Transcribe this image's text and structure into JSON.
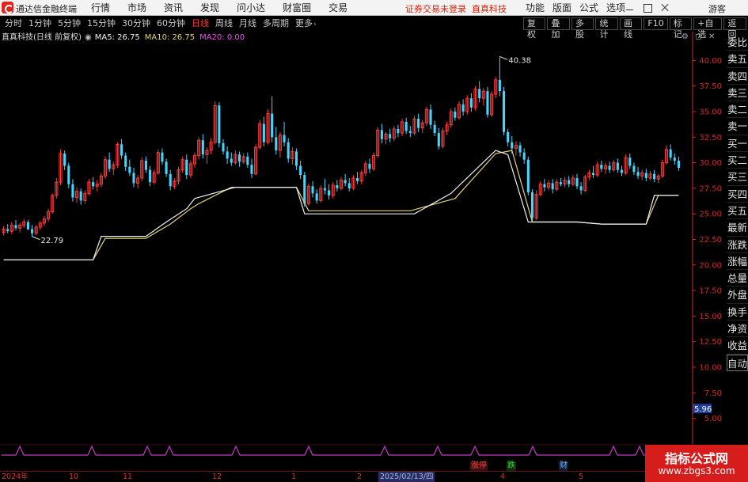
{
  "window": {
    "app_title": "通达信金融终端",
    "login_notice": "证券交易未登录",
    "login_stock": "直真科技",
    "guest_label": "游客"
  },
  "main_menu": [
    "行情",
    "市场",
    "资讯",
    "发现",
    "问小达",
    "财富圈",
    "交易"
  ],
  "right_menu": [
    "功能",
    "版面",
    "公式",
    "选项"
  ],
  "period_tabs": [
    {
      "label": "分时",
      "active": false
    },
    {
      "label": "1分钟",
      "active": false
    },
    {
      "label": "5分钟",
      "active": false
    },
    {
      "label": "15分钟",
      "active": false
    },
    {
      "label": "30分钟",
      "active": false
    },
    {
      "label": "60分钟",
      "active": false
    },
    {
      "label": "日线",
      "active": true
    },
    {
      "label": "周线",
      "active": false
    },
    {
      "label": "月线",
      "active": false
    },
    {
      "label": "多周期",
      "active": false
    },
    {
      "label": "更多",
      "active": false
    }
  ],
  "right_tools": [
    "复权",
    "叠加",
    "多股",
    "统计",
    "画线",
    "F10",
    "标记",
    "+自选",
    "返回"
  ],
  "info": {
    "stock_name": "直真科技(日线 前复权)",
    "ma5_label": "MA5: 26.75",
    "ma10_label": "MA10: 26.75",
    "ma20_label": "MA20: 0.00"
  },
  "side_tabs": [
    "委比",
    "卖五",
    "卖四",
    "卖三",
    "卖二",
    "卖一",
    "买一",
    "买二",
    "买三",
    "买四",
    "买五",
    "最新",
    "涨跌",
    "涨幅",
    "总量",
    "外盘",
    "换手",
    "净资",
    "收益",
    "自动"
  ],
  "y_axis": {
    "ticks": [
      "40.00",
      "37.50",
      "35.00",
      "32.50",
      "30.00",
      "27.50",
      "25.00",
      "22.50",
      "20.00",
      "17.50",
      "15.00",
      "12.50",
      "10.00",
      "7.50",
      "5.00"
    ],
    "current_label": "5.96"
  },
  "annotations": {
    "high": "40.38",
    "low": "22.79"
  },
  "date_ticks": [
    {
      "label": "2024年",
      "highlight": false
    },
    {
      "label": "10",
      "highlight": false
    },
    {
      "label": "11",
      "highlight": false
    },
    {
      "label": "12",
      "highlight": false
    },
    {
      "label": "1",
      "highlight": false
    },
    {
      "label": "2",
      "highlight": false
    },
    {
      "label": "2025/02/13/四",
      "highlight": true
    },
    {
      "label": "4",
      "highlight": false
    },
    {
      "label": "5",
      "highlight": false
    }
  ],
  "events": {
    "zhangting": "涨停",
    "dieting": "跌",
    "cai": "财"
  },
  "watermark": {
    "title": "指标公式网",
    "url": "www.zbgs3.com"
  },
  "colors": {
    "up": "#ff3c3c",
    "down": "#43d6ff",
    "ma_white": "#f0f0f0",
    "ma_yellow": "#e9d27a",
    "ma20": "#ff44ff",
    "axis": "#d02a2a",
    "pulse": "#c03cc0"
  },
  "chart_data": {
    "type": "candlestick",
    "y_range": [
      3.5,
      41.5
    ],
    "candles": [
      {
        "o": 23.2,
        "h": 23.8,
        "l": 22.9,
        "c": 23.5
      },
      {
        "o": 23.5,
        "h": 24.0,
        "l": 23.1,
        "c": 23.3
      },
      {
        "o": 23.3,
        "h": 24.2,
        "l": 23.0,
        "c": 23.9
      },
      {
        "o": 23.9,
        "h": 24.4,
        "l": 23.4,
        "c": 23.6
      },
      {
        "o": 23.6,
        "h": 24.1,
        "l": 23.2,
        "c": 23.9
      },
      {
        "o": 23.9,
        "h": 24.5,
        "l": 23.6,
        "c": 24.2
      },
      {
        "o": 24.2,
        "h": 24.4,
        "l": 23.4,
        "c": 23.5
      },
      {
        "o": 23.5,
        "h": 23.9,
        "l": 22.79,
        "c": 23.1
      },
      {
        "o": 23.1,
        "h": 23.9,
        "l": 22.9,
        "c": 23.7
      },
      {
        "o": 23.7,
        "h": 24.3,
        "l": 23.4,
        "c": 24.1
      },
      {
        "o": 24.1,
        "h": 24.8,
        "l": 23.8,
        "c": 24.5
      },
      {
        "o": 24.5,
        "h": 25.5,
        "l": 24.2,
        "c": 25.2
      },
      {
        "o": 25.2,
        "h": 27.0,
        "l": 25.0,
        "c": 26.8
      },
      {
        "o": 26.8,
        "h": 28.5,
        "l": 26.5,
        "c": 28.1
      },
      {
        "o": 28.1,
        "h": 31.3,
        "l": 27.8,
        "c": 30.9
      },
      {
        "o": 30.9,
        "h": 31.2,
        "l": 29.3,
        "c": 29.7
      },
      {
        "o": 29.7,
        "h": 30.0,
        "l": 27.5,
        "c": 27.9
      },
      {
        "o": 27.9,
        "h": 28.4,
        "l": 26.2,
        "c": 26.6
      },
      {
        "o": 26.6,
        "h": 27.6,
        "l": 26.1,
        "c": 27.2
      },
      {
        "o": 27.2,
        "h": 27.5,
        "l": 25.9,
        "c": 26.3
      },
      {
        "o": 26.3,
        "h": 27.3,
        "l": 26.0,
        "c": 27.0
      },
      {
        "o": 27.0,
        "h": 28.4,
        "l": 26.8,
        "c": 28.1
      },
      {
        "o": 28.1,
        "h": 28.6,
        "l": 27.4,
        "c": 27.7
      },
      {
        "o": 27.7,
        "h": 28.3,
        "l": 27.2,
        "c": 27.9
      },
      {
        "o": 27.9,
        "h": 29.0,
        "l": 27.6,
        "c": 28.7
      },
      {
        "o": 28.7,
        "h": 30.6,
        "l": 28.4,
        "c": 30.3
      },
      {
        "o": 30.3,
        "h": 31.0,
        "l": 29.1,
        "c": 29.4
      },
      {
        "o": 29.4,
        "h": 30.1,
        "l": 28.8,
        "c": 29.8
      },
      {
        "o": 29.8,
        "h": 32.0,
        "l": 29.5,
        "c": 31.8
      },
      {
        "o": 31.8,
        "h": 32.3,
        "l": 30.4,
        "c": 30.7
      },
      {
        "o": 30.7,
        "h": 31.0,
        "l": 29.2,
        "c": 29.6
      },
      {
        "o": 29.6,
        "h": 30.3,
        "l": 28.7,
        "c": 29.0
      },
      {
        "o": 29.0,
        "h": 29.5,
        "l": 27.6,
        "c": 28.0
      },
      {
        "o": 28.0,
        "h": 28.8,
        "l": 27.5,
        "c": 28.5
      },
      {
        "o": 28.5,
        "h": 30.5,
        "l": 28.2,
        "c": 30.2
      },
      {
        "o": 30.2,
        "h": 30.6,
        "l": 29.0,
        "c": 29.3
      },
      {
        "o": 29.3,
        "h": 29.7,
        "l": 27.7,
        "c": 28.1
      },
      {
        "o": 28.1,
        "h": 29.3,
        "l": 27.9,
        "c": 29.0
      },
      {
        "o": 29.0,
        "h": 31.3,
        "l": 28.8,
        "c": 31.0
      },
      {
        "o": 31.0,
        "h": 31.4,
        "l": 29.8,
        "c": 30.1
      },
      {
        "o": 30.1,
        "h": 30.4,
        "l": 28.6,
        "c": 28.9
      },
      {
        "o": 28.9,
        "h": 29.3,
        "l": 27.3,
        "c": 27.7
      },
      {
        "o": 27.7,
        "h": 28.5,
        "l": 27.4,
        "c": 28.2
      },
      {
        "o": 28.2,
        "h": 29.6,
        "l": 27.9,
        "c": 29.3
      },
      {
        "o": 29.3,
        "h": 30.6,
        "l": 29.0,
        "c": 30.3
      },
      {
        "o": 30.3,
        "h": 30.8,
        "l": 28.4,
        "c": 28.8
      },
      {
        "o": 28.8,
        "h": 30.2,
        "l": 28.5,
        "c": 29.9
      },
      {
        "o": 29.9,
        "h": 31.0,
        "l": 29.5,
        "c": 30.7
      },
      {
        "o": 30.7,
        "h": 32.5,
        "l": 30.3,
        "c": 32.2
      },
      {
        "o": 32.2,
        "h": 32.8,
        "l": 30.4,
        "c": 30.8
      },
      {
        "o": 30.8,
        "h": 31.5,
        "l": 29.9,
        "c": 31.2
      },
      {
        "o": 31.2,
        "h": 32.4,
        "l": 30.8,
        "c": 32.0
      },
      {
        "o": 32.0,
        "h": 36.0,
        "l": 31.8,
        "c": 35.6
      },
      {
        "o": 35.6,
        "h": 35.9,
        "l": 31.5,
        "c": 31.9
      },
      {
        "o": 31.9,
        "h": 32.3,
        "l": 30.8,
        "c": 31.1
      },
      {
        "o": 31.1,
        "h": 31.6,
        "l": 29.9,
        "c": 30.4
      },
      {
        "o": 30.4,
        "h": 31.0,
        "l": 29.7,
        "c": 30.0
      },
      {
        "o": 30.0,
        "h": 31.2,
        "l": 29.8,
        "c": 30.8
      },
      {
        "o": 30.8,
        "h": 31.1,
        "l": 29.6,
        "c": 30.1
      },
      {
        "o": 30.1,
        "h": 30.9,
        "l": 29.9,
        "c": 30.6
      },
      {
        "o": 30.6,
        "h": 31.0,
        "l": 29.5,
        "c": 29.8
      },
      {
        "o": 29.8,
        "h": 30.4,
        "l": 28.5,
        "c": 28.9
      },
      {
        "o": 28.9,
        "h": 31.8,
        "l": 28.8,
        "c": 31.5
      },
      {
        "o": 31.5,
        "h": 34.2,
        "l": 31.3,
        "c": 33.8
      },
      {
        "o": 33.8,
        "h": 34.5,
        "l": 31.6,
        "c": 32.0
      },
      {
        "o": 32.0,
        "h": 35.2,
        "l": 31.8,
        "c": 34.8
      },
      {
        "o": 34.8,
        "h": 36.5,
        "l": 32.0,
        "c": 32.5
      },
      {
        "o": 32.5,
        "h": 33.5,
        "l": 30.8,
        "c": 31.2
      },
      {
        "o": 31.2,
        "h": 33.0,
        "l": 30.5,
        "c": 32.7
      },
      {
        "o": 32.7,
        "h": 34.0,
        "l": 31.6,
        "c": 32.0
      },
      {
        "o": 32.0,
        "h": 32.4,
        "l": 30.0,
        "c": 30.4
      },
      {
        "o": 30.4,
        "h": 31.5,
        "l": 29.8,
        "c": 31.1
      },
      {
        "o": 31.1,
        "h": 31.4,
        "l": 29.3,
        "c": 29.7
      },
      {
        "o": 29.7,
        "h": 30.2,
        "l": 28.4,
        "c": 28.8
      },
      {
        "o": 28.8,
        "h": 29.1,
        "l": 25.7,
        "c": 26.0
      },
      {
        "o": 26.0,
        "h": 28.0,
        "l": 25.8,
        "c": 27.7
      },
      {
        "o": 27.7,
        "h": 28.2,
        "l": 26.6,
        "c": 27.0
      },
      {
        "o": 27.0,
        "h": 27.4,
        "l": 26.0,
        "c": 26.3
      },
      {
        "o": 26.3,
        "h": 27.8,
        "l": 26.1,
        "c": 27.5
      },
      {
        "o": 27.5,
        "h": 28.4,
        "l": 26.9,
        "c": 27.3
      },
      {
        "o": 27.3,
        "h": 27.9,
        "l": 26.4,
        "c": 26.8
      },
      {
        "o": 26.8,
        "h": 28.1,
        "l": 26.5,
        "c": 27.8
      },
      {
        "o": 27.8,
        "h": 28.3,
        "l": 27.2,
        "c": 27.5
      },
      {
        "o": 27.5,
        "h": 28.6,
        "l": 27.3,
        "c": 28.3
      },
      {
        "o": 28.3,
        "h": 28.9,
        "l": 27.7,
        "c": 28.0
      },
      {
        "o": 28.0,
        "h": 28.5,
        "l": 27.2,
        "c": 27.5
      },
      {
        "o": 27.5,
        "h": 28.8,
        "l": 27.3,
        "c": 28.5
      },
      {
        "o": 28.5,
        "h": 29.1,
        "l": 27.9,
        "c": 28.2
      },
      {
        "o": 28.2,
        "h": 29.3,
        "l": 27.9,
        "c": 29.0
      },
      {
        "o": 29.0,
        "h": 30.2,
        "l": 28.7,
        "c": 29.9
      },
      {
        "o": 29.9,
        "h": 30.4,
        "l": 29.0,
        "c": 29.4
      },
      {
        "o": 29.4,
        "h": 31.0,
        "l": 29.2,
        "c": 30.7
      },
      {
        "o": 30.7,
        "h": 33.5,
        "l": 30.5,
        "c": 33.2
      },
      {
        "o": 33.2,
        "h": 33.8,
        "l": 31.9,
        "c": 32.3
      },
      {
        "o": 32.3,
        "h": 33.0,
        "l": 31.8,
        "c": 32.8
      },
      {
        "o": 32.8,
        "h": 33.3,
        "l": 32.0,
        "c": 32.4
      },
      {
        "o": 32.4,
        "h": 33.6,
        "l": 32.1,
        "c": 33.3
      },
      {
        "o": 33.3,
        "h": 33.7,
        "l": 32.5,
        "c": 32.9
      },
      {
        "o": 32.9,
        "h": 34.3,
        "l": 32.6,
        "c": 34.0
      },
      {
        "o": 34.0,
        "h": 34.4,
        "l": 32.8,
        "c": 33.1
      },
      {
        "o": 33.1,
        "h": 33.6,
        "l": 32.5,
        "c": 32.9
      },
      {
        "o": 32.9,
        "h": 34.6,
        "l": 32.7,
        "c": 34.3
      },
      {
        "o": 34.3,
        "h": 34.8,
        "l": 33.0,
        "c": 33.4
      },
      {
        "o": 33.4,
        "h": 34.2,
        "l": 32.9,
        "c": 33.9
      },
      {
        "o": 33.9,
        "h": 35.5,
        "l": 33.6,
        "c": 35.2
      },
      {
        "o": 35.2,
        "h": 35.7,
        "l": 33.3,
        "c": 33.7
      },
      {
        "o": 33.7,
        "h": 34.1,
        "l": 32.6,
        "c": 32.9
      },
      {
        "o": 32.9,
        "h": 33.4,
        "l": 31.3,
        "c": 31.6
      },
      {
        "o": 31.6,
        "h": 33.4,
        "l": 31.4,
        "c": 33.1
      },
      {
        "o": 33.1,
        "h": 34.0,
        "l": 32.7,
        "c": 33.7
      },
      {
        "o": 33.7,
        "h": 35.3,
        "l": 33.4,
        "c": 35.0
      },
      {
        "o": 35.0,
        "h": 35.4,
        "l": 34.1,
        "c": 34.4
      },
      {
        "o": 34.4,
        "h": 36.0,
        "l": 34.2,
        "c": 35.7
      },
      {
        "o": 35.7,
        "h": 36.2,
        "l": 34.6,
        "c": 35.0
      },
      {
        "o": 35.0,
        "h": 36.6,
        "l": 34.7,
        "c": 36.3
      },
      {
        "o": 36.3,
        "h": 36.8,
        "l": 35.0,
        "c": 35.4
      },
      {
        "o": 35.4,
        "h": 37.5,
        "l": 35.1,
        "c": 37.2
      },
      {
        "o": 37.2,
        "h": 38.0,
        "l": 35.9,
        "c": 36.3
      },
      {
        "o": 36.3,
        "h": 37.3,
        "l": 35.6,
        "c": 37.0
      },
      {
        "o": 37.0,
        "h": 37.4,
        "l": 34.4,
        "c": 34.7
      },
      {
        "o": 34.7,
        "h": 37.0,
        "l": 34.5,
        "c": 36.7
      },
      {
        "o": 36.7,
        "h": 38.4,
        "l": 36.3,
        "c": 38.1
      },
      {
        "o": 38.1,
        "h": 40.38,
        "l": 36.5,
        "c": 37.0
      },
      {
        "o": 37.0,
        "h": 37.4,
        "l": 32.7,
        "c": 33.0
      },
      {
        "o": 33.0,
        "h": 33.3,
        "l": 31.6,
        "c": 32.0
      },
      {
        "o": 32.0,
        "h": 32.6,
        "l": 30.9,
        "c": 31.4
      },
      {
        "o": 31.4,
        "h": 32.1,
        "l": 30.7,
        "c": 31.7
      },
      {
        "o": 31.7,
        "h": 32.0,
        "l": 30.6,
        "c": 31.0
      },
      {
        "o": 31.0,
        "h": 31.4,
        "l": 29.9,
        "c": 30.3
      },
      {
        "o": 30.3,
        "h": 30.6,
        "l": 26.8,
        "c": 27.1
      },
      {
        "o": 27.1,
        "h": 27.4,
        "l": 24.3,
        "c": 24.6
      },
      {
        "o": 24.6,
        "h": 27.3,
        "l": 24.4,
        "c": 26.9
      },
      {
        "o": 26.9,
        "h": 28.2,
        "l": 26.7,
        "c": 27.9
      },
      {
        "o": 27.9,
        "h": 28.4,
        "l": 27.2,
        "c": 27.6
      },
      {
        "o": 27.6,
        "h": 28.3,
        "l": 27.3,
        "c": 28.0
      },
      {
        "o": 28.0,
        "h": 28.4,
        "l": 27.0,
        "c": 27.4
      },
      {
        "o": 27.4,
        "h": 28.4,
        "l": 27.2,
        "c": 28.1
      },
      {
        "o": 28.1,
        "h": 28.5,
        "l": 27.7,
        "c": 27.9
      },
      {
        "o": 27.9,
        "h": 28.6,
        "l": 27.6,
        "c": 28.3
      },
      {
        "o": 28.3,
        "h": 28.7,
        "l": 27.6,
        "c": 27.9
      },
      {
        "o": 27.9,
        "h": 28.8,
        "l": 27.7,
        "c": 28.5
      },
      {
        "o": 28.5,
        "h": 28.9,
        "l": 27.4,
        "c": 27.7
      },
      {
        "o": 27.7,
        "h": 28.1,
        "l": 26.9,
        "c": 27.3
      },
      {
        "o": 27.3,
        "h": 28.8,
        "l": 27.1,
        "c": 28.6
      },
      {
        "o": 28.6,
        "h": 29.3,
        "l": 28.3,
        "c": 29.0
      },
      {
        "o": 29.0,
        "h": 29.7,
        "l": 28.5,
        "c": 28.8
      },
      {
        "o": 28.8,
        "h": 30.1,
        "l": 28.6,
        "c": 29.8
      },
      {
        "o": 29.8,
        "h": 30.2,
        "l": 29.1,
        "c": 29.4
      },
      {
        "o": 29.4,
        "h": 30.0,
        "l": 28.9,
        "c": 29.7
      },
      {
        "o": 29.7,
        "h": 30.1,
        "l": 29.0,
        "c": 29.3
      },
      {
        "o": 29.3,
        "h": 30.3,
        "l": 29.1,
        "c": 30.0
      },
      {
        "o": 30.0,
        "h": 30.4,
        "l": 29.0,
        "c": 29.3
      },
      {
        "o": 29.3,
        "h": 29.7,
        "l": 28.7,
        "c": 29.0
      },
      {
        "o": 29.0,
        "h": 30.8,
        "l": 28.8,
        "c": 30.5
      },
      {
        "o": 30.5,
        "h": 30.9,
        "l": 29.4,
        "c": 29.7
      },
      {
        "o": 29.7,
        "h": 30.0,
        "l": 28.8,
        "c": 29.1
      },
      {
        "o": 29.1,
        "h": 29.6,
        "l": 28.4,
        "c": 28.7
      },
      {
        "o": 28.7,
        "h": 29.3,
        "l": 28.3,
        "c": 29.0
      },
      {
        "o": 29.0,
        "h": 29.4,
        "l": 28.2,
        "c": 28.5
      },
      {
        "o": 28.5,
        "h": 29.2,
        "l": 28.3,
        "c": 28.9
      },
      {
        "o": 28.9,
        "h": 29.3,
        "l": 28.1,
        "c": 28.4
      },
      {
        "o": 28.4,
        "h": 28.9,
        "l": 28.0,
        "c": 28.7
      },
      {
        "o": 28.7,
        "h": 30.3,
        "l": 28.5,
        "c": 30.0
      },
      {
        "o": 30.0,
        "h": 31.7,
        "l": 29.8,
        "c": 31.3
      },
      {
        "o": 31.3,
        "h": 31.8,
        "l": 30.2,
        "c": 30.5
      },
      {
        "o": 30.5,
        "h": 30.9,
        "l": 29.8,
        "c": 30.2
      },
      {
        "o": 30.2,
        "h": 30.6,
        "l": 29.2,
        "c": 29.5
      }
    ],
    "ma_white_steps": [
      [
        0,
        20.5
      ],
      [
        22,
        20.5
      ],
      [
        24,
        22.8
      ],
      [
        35,
        22.8
      ],
      [
        40,
        24.2
      ],
      [
        45,
        25.5
      ],
      [
        47,
        26.5
      ],
      [
        57,
        27.6
      ],
      [
        72,
        27.6
      ],
      [
        74,
        25.0
      ],
      [
        101,
        25.0
      ],
      [
        110,
        27.0
      ],
      [
        121,
        31.2
      ],
      [
        124,
        30.8
      ],
      [
        129,
        24.2
      ],
      [
        141,
        24.2
      ],
      [
        147,
        24.0
      ],
      [
        158,
        24.0
      ],
      [
        160,
        26.8
      ],
      [
        166,
        26.8
      ]
    ],
    "ma_yellow_steps": [
      [
        0,
        20.5
      ],
      [
        22,
        20.5
      ],
      [
        25,
        22.6
      ],
      [
        35,
        22.6
      ],
      [
        41,
        24.0
      ],
      [
        46,
        25.5
      ],
      [
        48,
        26.0
      ],
      [
        56,
        27.6
      ],
      [
        72,
        27.6
      ],
      [
        75,
        25.3
      ],
      [
        100,
        25.3
      ],
      [
        111,
        26.5
      ],
      [
        121,
        30.9
      ],
      [
        125,
        31.2
      ],
      [
        130,
        24.2
      ],
      [
        141,
        24.2
      ],
      [
        147,
        24.0
      ],
      [
        158,
        24.0
      ],
      [
        161,
        26.8
      ],
      [
        166,
        26.8
      ]
    ]
  }
}
